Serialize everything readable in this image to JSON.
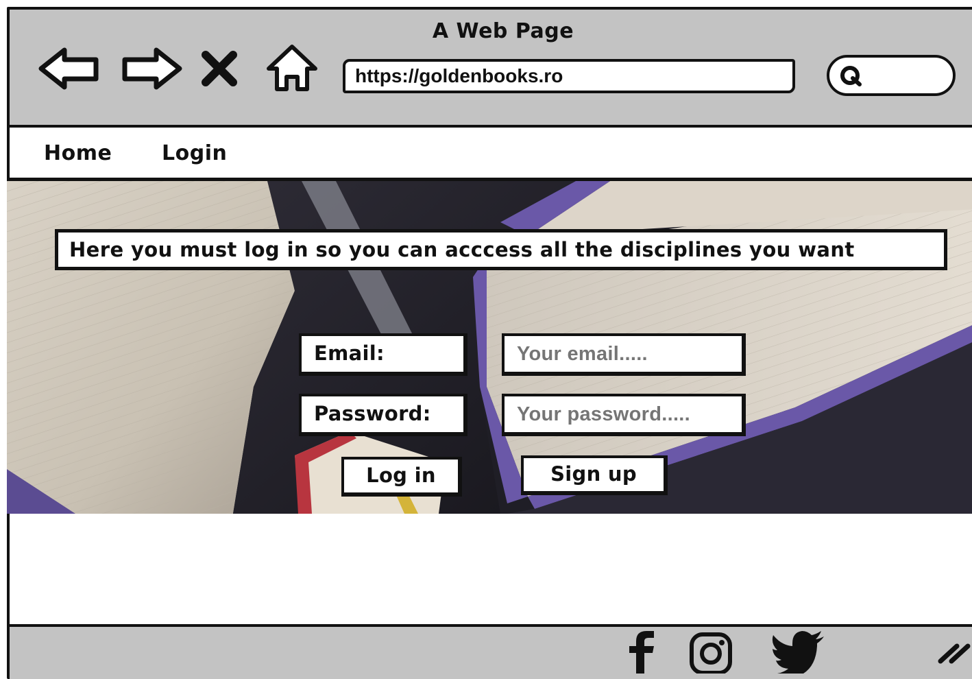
{
  "window": {
    "title": "A Web Page"
  },
  "browser": {
    "url": "https://goldenbooks.ro",
    "search_placeholder": "",
    "nav_icons": [
      "back-arrow-icon",
      "forward-arrow-icon",
      "close-x-icon",
      "home-icon"
    ]
  },
  "menu": {
    "items": [
      {
        "label": "Home"
      },
      {
        "label": "Login"
      }
    ]
  },
  "hero": {
    "notice": "Here you must log in so you can acccess all the disciplines you want",
    "background": "open-books-photo"
  },
  "form": {
    "email_label": "Email:",
    "email_placeholder": "Your email.....",
    "password_label": "Password:",
    "password_placeholder": "Your password.....",
    "login_button": "Log in",
    "signup_button": "Sign up"
  },
  "footer": {
    "social_icons": [
      "facebook-icon",
      "instagram-icon",
      "twitter-icon"
    ]
  },
  "colors": {
    "chrome": "#c3c3c3",
    "border": "#111111",
    "page": "#ffffff"
  }
}
